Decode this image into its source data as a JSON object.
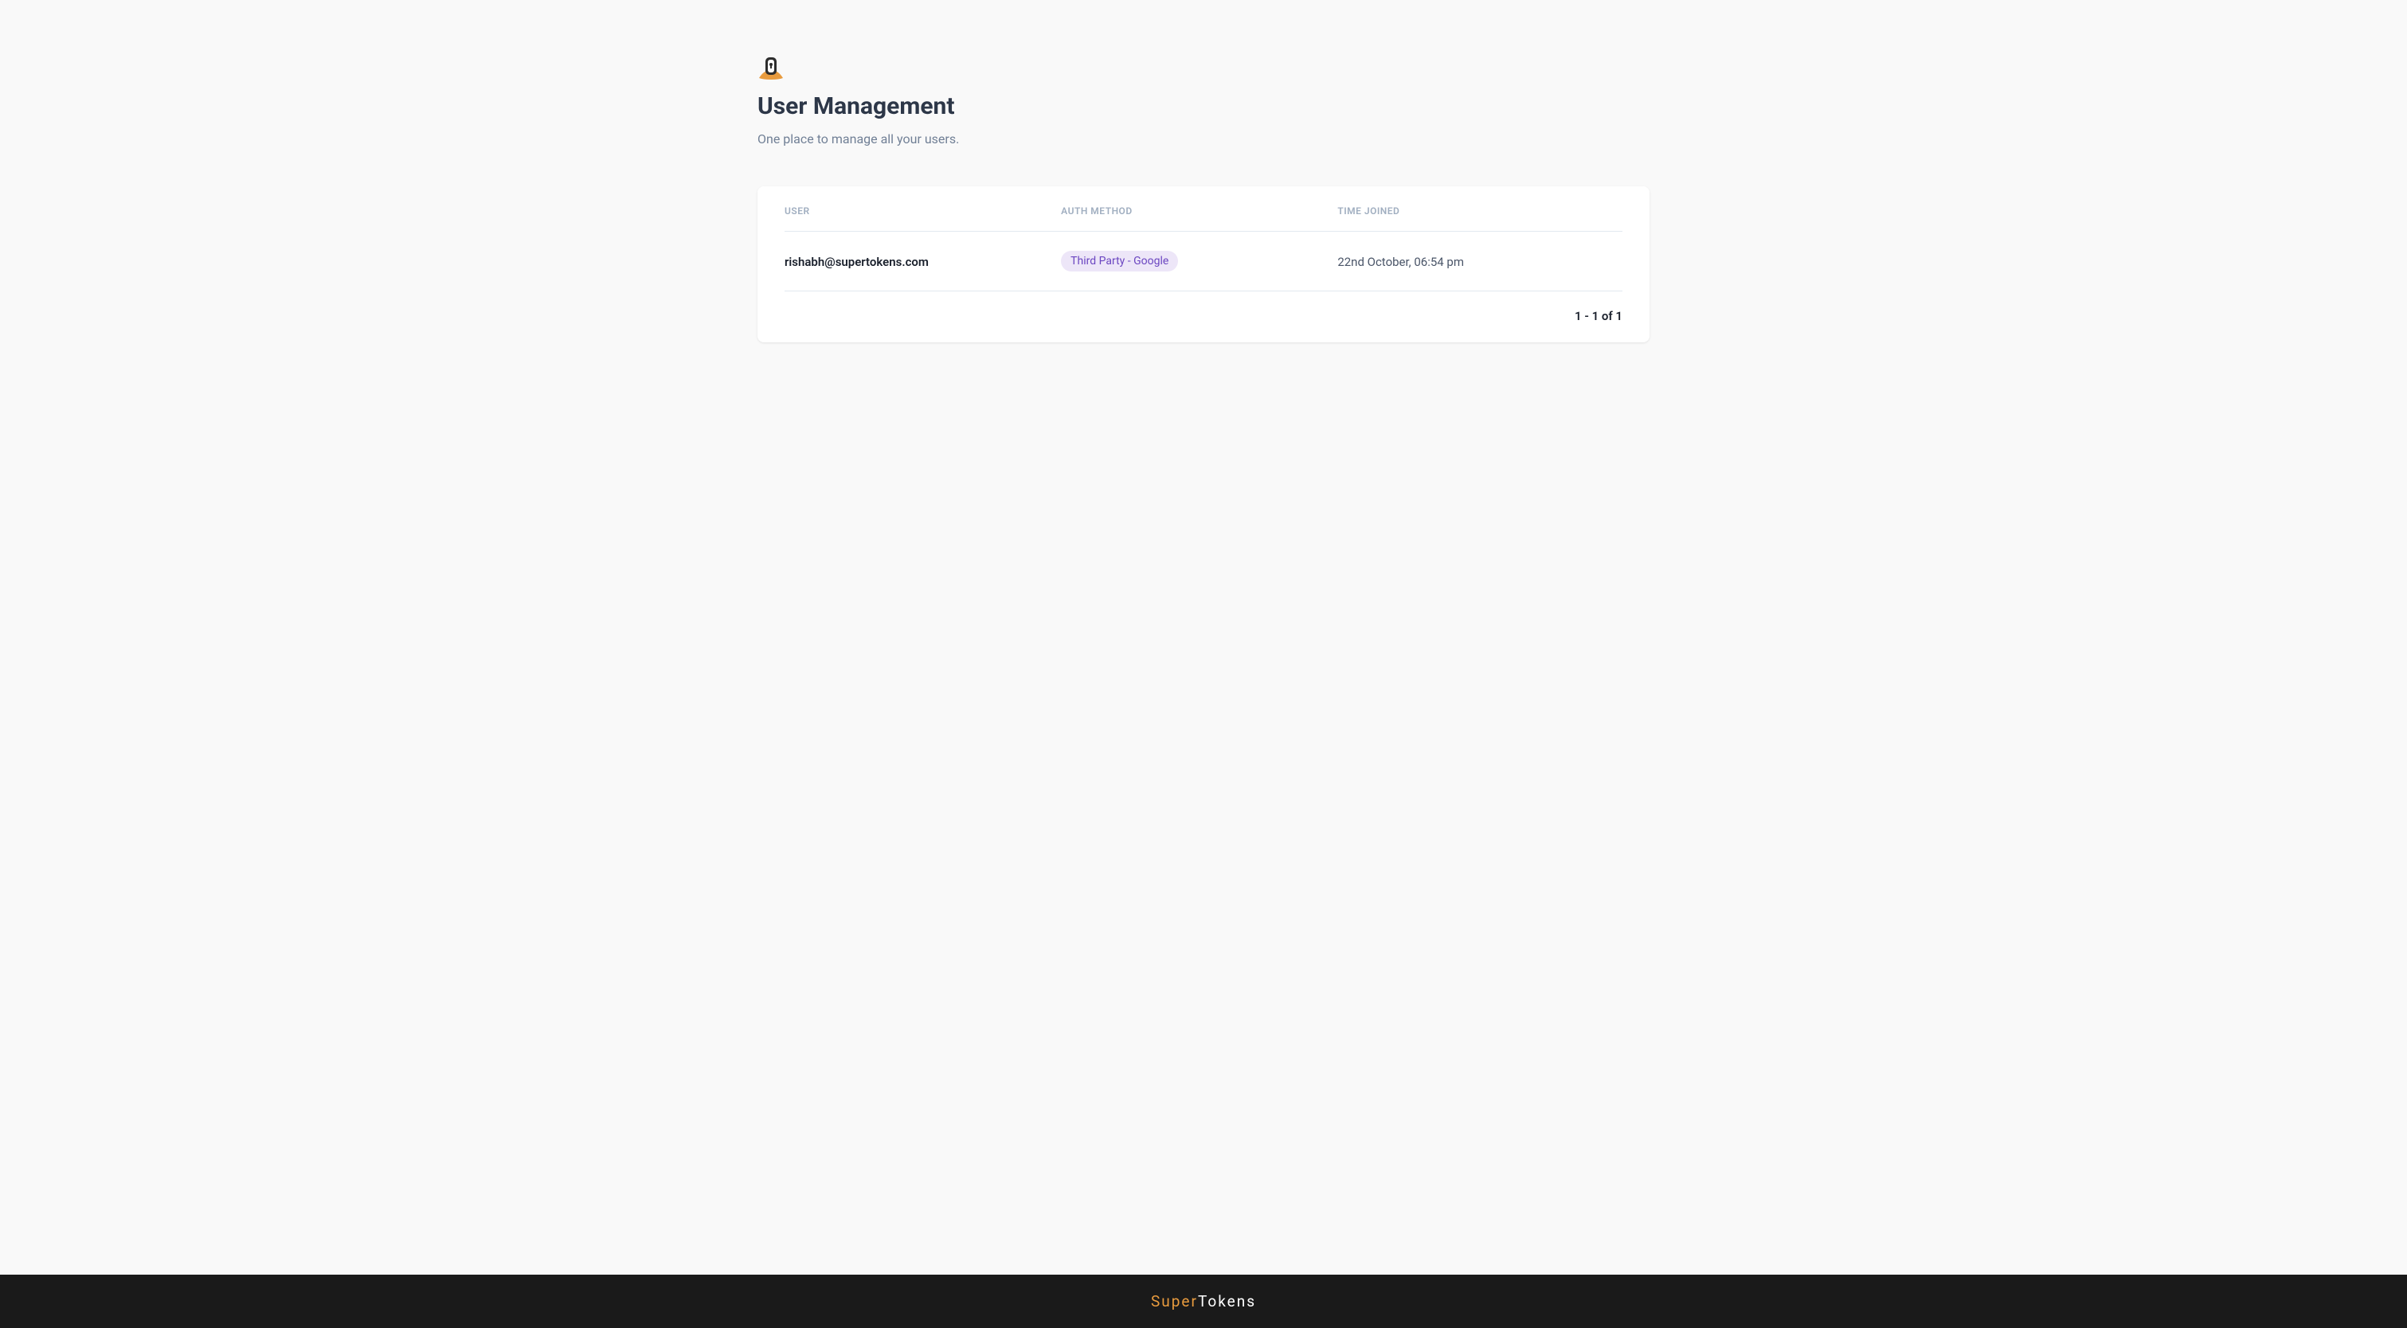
{
  "header": {
    "title": "User Management",
    "subtitle": "One place to manage all your users."
  },
  "table": {
    "columns": {
      "user": "USER",
      "auth_method": "AUTH METHOD",
      "time_joined": "TIME JOINED"
    },
    "rows": [
      {
        "user": "rishabh@supertokens.com",
        "auth_method": "Third Party - Google",
        "time_joined": "22nd October, 06:54 pm"
      }
    ]
  },
  "pagination": {
    "text": "1 - 1 of 1"
  },
  "footer": {
    "logo_part1": "Super",
    "logo_part2": "Tokens"
  }
}
